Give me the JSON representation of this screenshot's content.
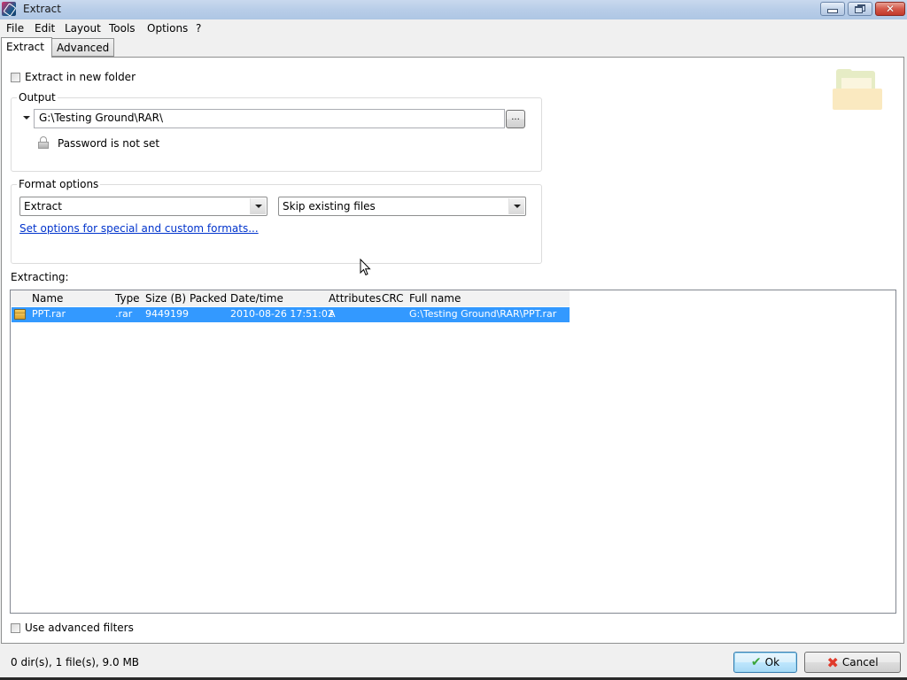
{
  "window": {
    "title": "Extract",
    "controls": {
      "minimize": "minimize",
      "restore": "restore",
      "close": "close"
    }
  },
  "menu": [
    "File",
    "Edit",
    "Layout",
    "Tools",
    "Options",
    "?"
  ],
  "tabs": [
    {
      "label": "Extract",
      "active": true
    },
    {
      "label": "Advanced",
      "active": false
    }
  ],
  "extract_tab": {
    "extract_in_new_folder": {
      "label": "Extract in new folder",
      "checked": false
    },
    "output": {
      "group_label": "Output",
      "path": "G:\\Testing Ground\\RAR\\",
      "browse_label": "...",
      "password_status": "Password is not set"
    },
    "format_options": {
      "group_label": "Format options",
      "action_select": "Extract",
      "overwrite_select": "Skip existing files",
      "custom_formats_link": "Set options for special and custom formats..."
    },
    "extracting_label": "Extracting:",
    "file_list": {
      "columns": [
        "Name",
        "Type",
        "Size (B)",
        "Packed",
        "Date/time",
        "Attributes",
        "CRC",
        "Full name"
      ],
      "rows": [
        {
          "name": "PPT.rar",
          "type": ".rar",
          "size": "9449199",
          "packed": "",
          "datetime": "2010-08-26 17:51:02",
          "attributes": "A",
          "crc": "",
          "full_name": "G:\\Testing Ground\\RAR\\PPT.rar",
          "selected": true
        }
      ]
    },
    "use_advanced_filters": {
      "label": "Use advanced filters",
      "checked": false
    }
  },
  "status_bar": "0 dir(s), 1 file(s), 9.0 MB",
  "buttons": {
    "ok": "Ok",
    "cancel": "Cancel"
  },
  "colors": {
    "selection": "#3399ff",
    "link": "#0033cc"
  }
}
